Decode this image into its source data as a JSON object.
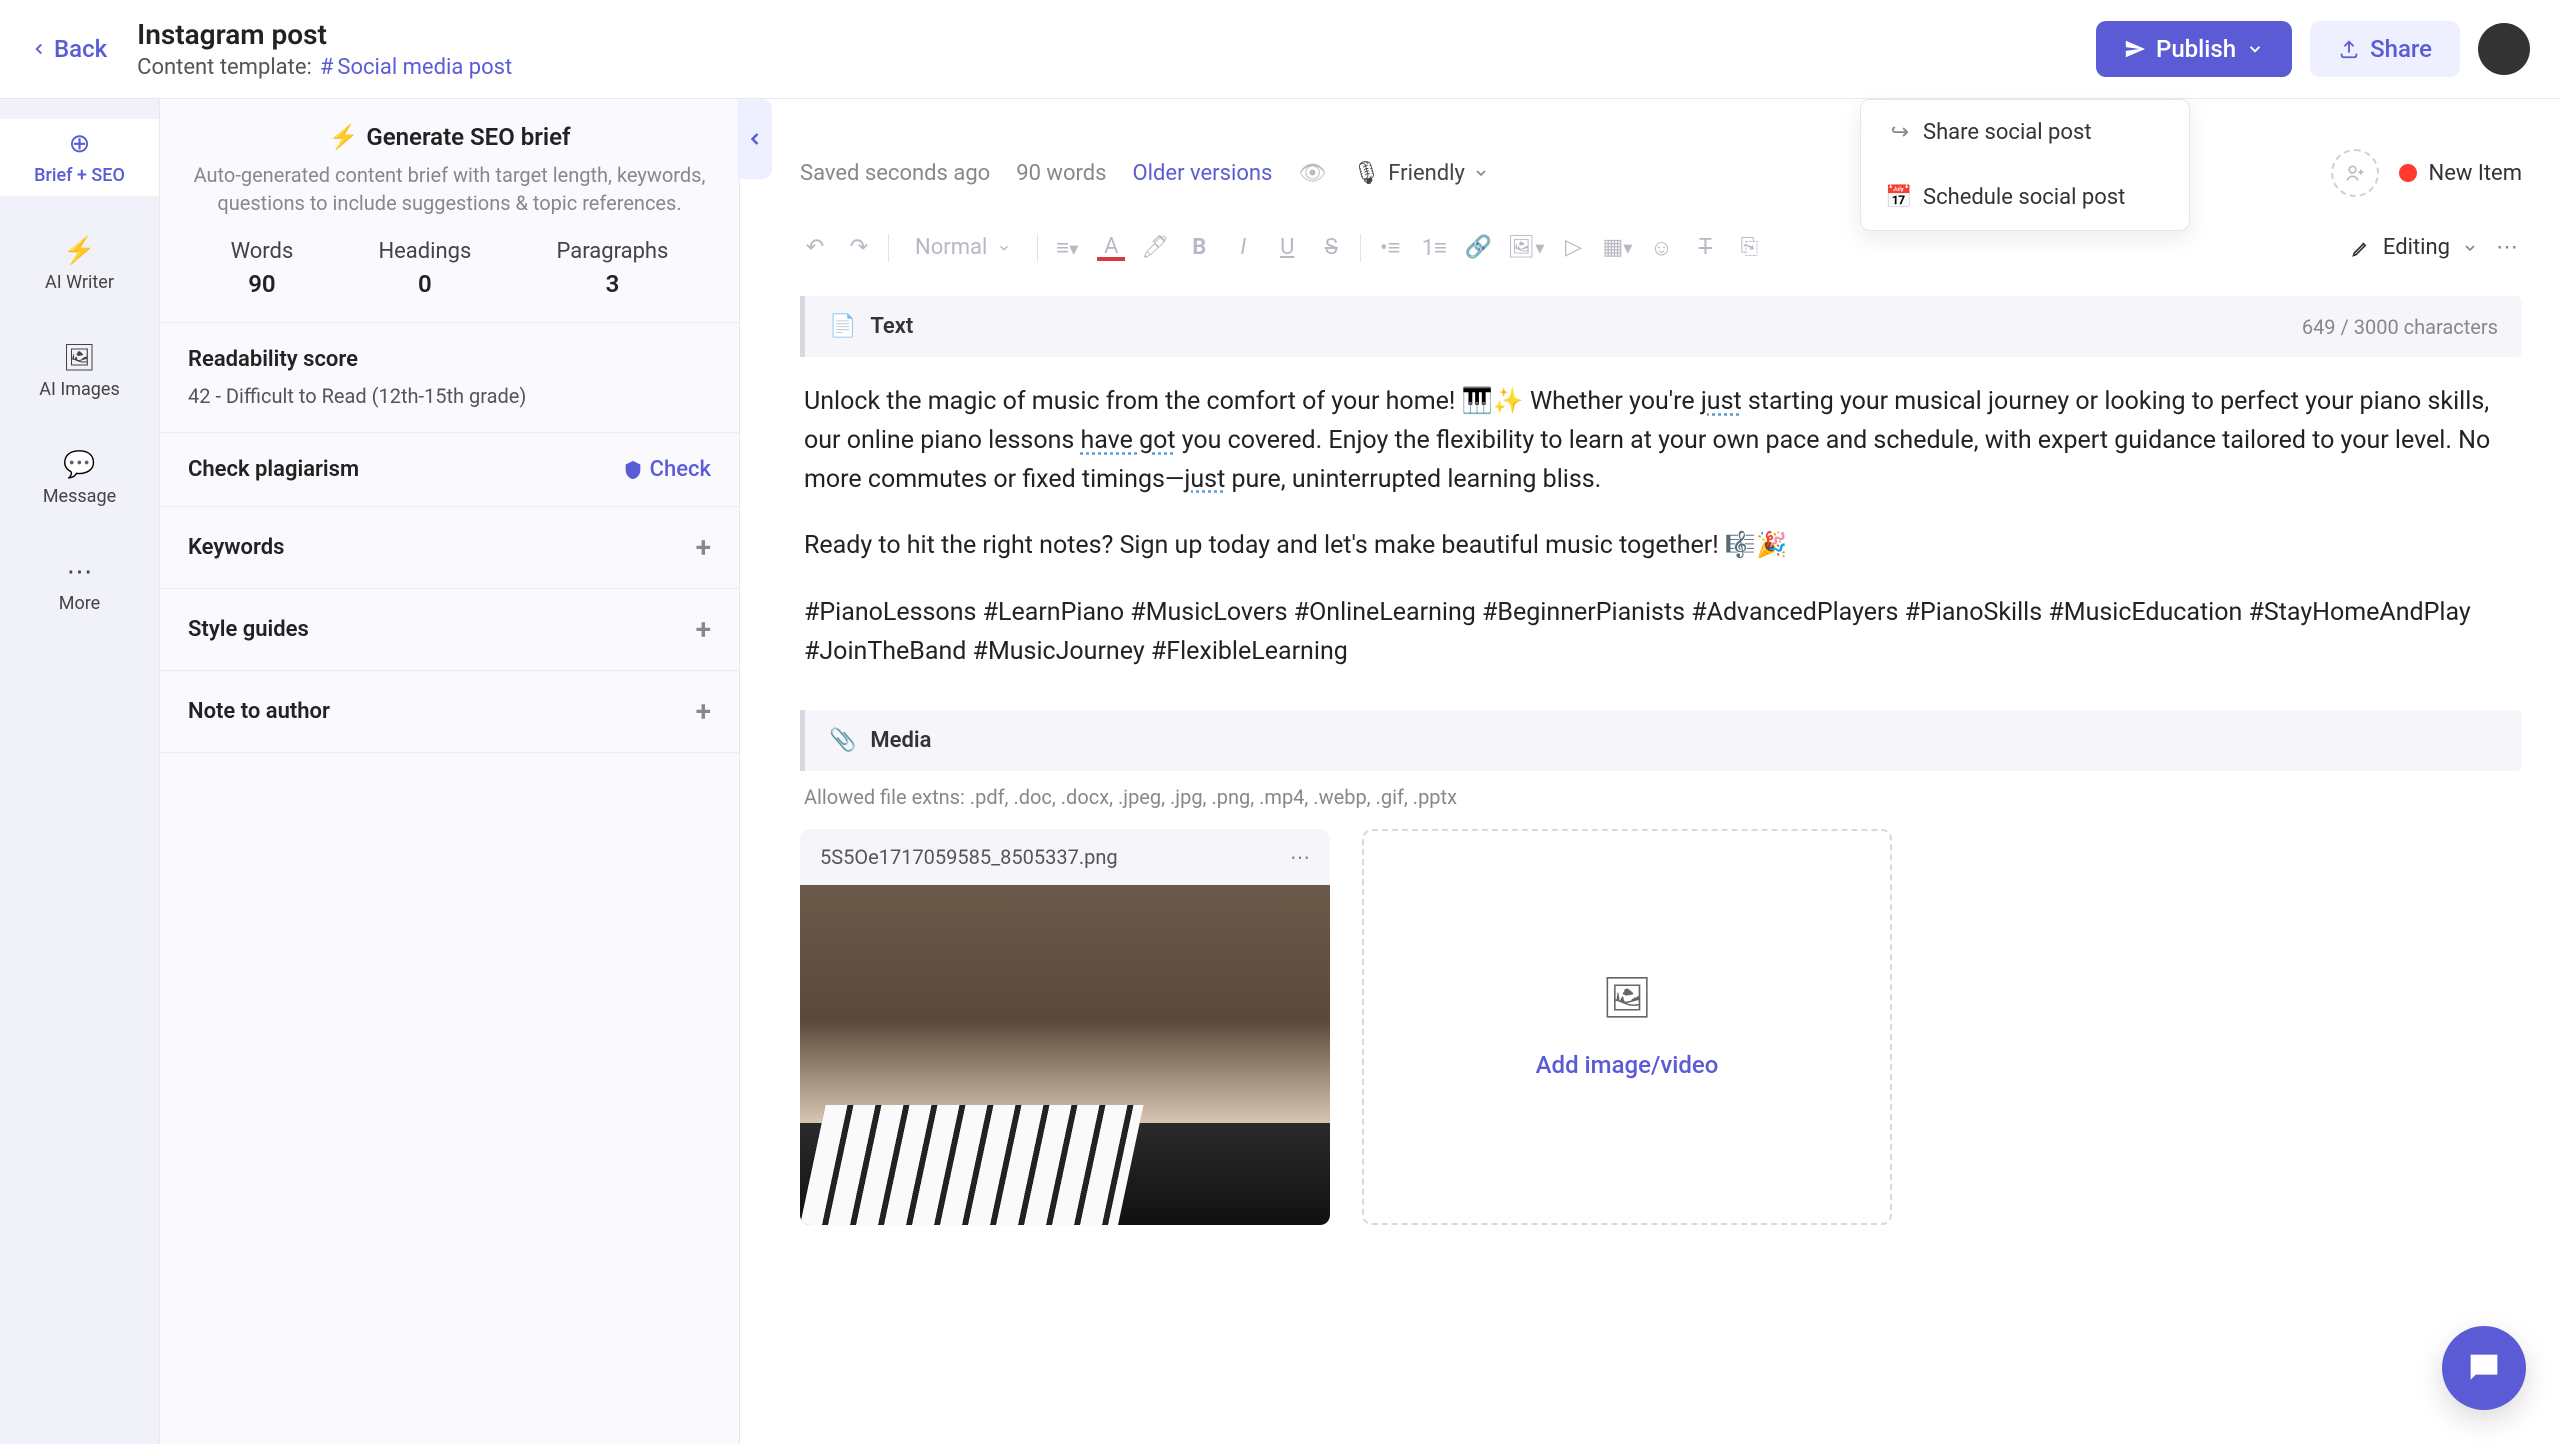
{
  "header": {
    "back": "Back",
    "title": "Instagram post",
    "template_label": "Content template:",
    "template_tag": "Social media post",
    "publish": "Publish",
    "share": "Share"
  },
  "publish_menu": {
    "share_post": "Share social post",
    "schedule_post": "Schedule social post"
  },
  "rail": {
    "brief": "Brief + SEO",
    "writer": "AI Writer",
    "images": "AI Images",
    "message": "Message",
    "more": "More"
  },
  "brief": {
    "generate_title": "Generate SEO brief",
    "generate_desc": "Auto-generated content brief with target length, keywords, questions to include suggestions & topic references.",
    "metrics": {
      "words_label": "Words",
      "words_value": "90",
      "headings_label": "Headings",
      "headings_value": "0",
      "paragraphs_label": "Paragraphs",
      "paragraphs_value": "3"
    },
    "readability_title": "Readability score",
    "readability_value": "42 - Difficult to Read (12th-15th grade)",
    "plagiarism_title": "Check plagiarism",
    "plagiarism_check": "Check",
    "keywords_title": "Keywords",
    "styleguides_title": "Style guides",
    "note_title": "Note to author"
  },
  "editor_meta": {
    "saved": "Saved seconds ago",
    "words": "90 words",
    "older": "Older versions",
    "tone": "Friendly",
    "new_item": "New Item"
  },
  "toolbar": {
    "style": "Normal",
    "editing": "Editing"
  },
  "text_block": {
    "label": "Text",
    "count": "649 / 3000 characters",
    "para1_a": "Unlock the magic of music from the comfort of your home! 🎹✨ Whether you're ",
    "para1_just1": "just",
    "para1_b": " starting your musical journey or looking to perfect your piano skills, our online piano lessons ",
    "para1_havegot": "have got",
    "para1_c": " you covered. Enjoy the flexibility to learn at your own pace and schedule, with expert guidance tailored to your level. No more commutes or fixed timings—",
    "para1_just2": "just",
    "para1_d": " pure, uninterrupted learning bliss.",
    "para2": "Ready to hit the right notes? Sign up today and let's make beautiful music together! 🎼🎉",
    "para3": "#PianoLessons #LearnPiano #MusicLovers #OnlineLearning #BeginnerPianists #AdvancedPlayers #PianoSkills #MusicEducation #StayHomeAndPlay #JoinTheBand #MusicJourney #FlexibleLearning"
  },
  "media_block": {
    "label": "Media",
    "allowed": "Allowed file extns: .pdf, .doc, .docx, .jpeg, .jpg, .png, .mp4, .webp, .gif, .pptx",
    "filename": "5S5Oe1717059585_8505337.png",
    "add": "Add image/video"
  }
}
